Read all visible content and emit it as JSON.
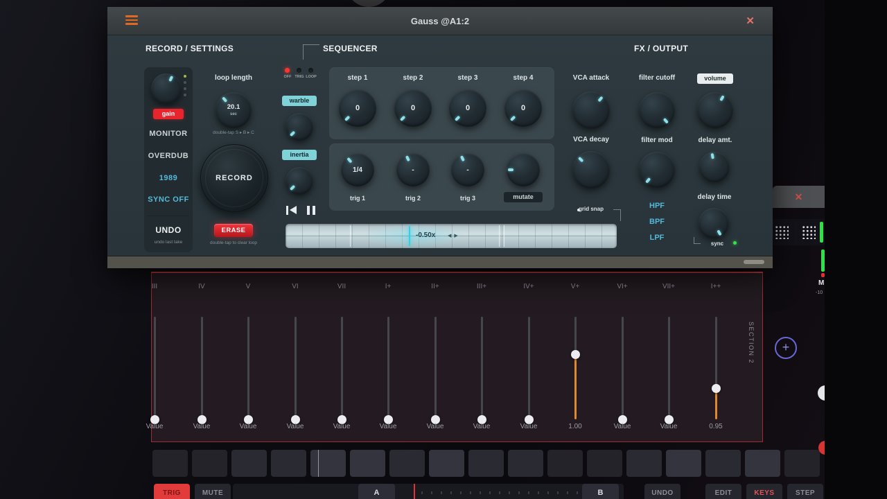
{
  "window": {
    "title": "Gauss @A1:2",
    "icons": {
      "close": "✕"
    }
  },
  "sections": {
    "record_header": "RECORD / SETTINGS",
    "sequencer_header": "SEQUENCER",
    "fx_header": "FX / OUTPUT"
  },
  "record": {
    "gain_badge": "gain",
    "monitor": "MONITOR",
    "overdub": "OVERDUB",
    "year": "1989",
    "sync": "SYNC OFF",
    "undo": "UNDO",
    "undo_hint": "undo last take",
    "loop_length_label": "loop length",
    "loop_value": "20.1",
    "loop_unit": "sec",
    "loop_hint": "double-tap  S ▸ B ▸ C",
    "record_button": "RECORD",
    "erase_button": "ERASE",
    "erase_hint": "double-tap to clear loop"
  },
  "sequencer": {
    "modes": [
      "OFF",
      "TRIG",
      "LOOP"
    ],
    "warble": "warble",
    "inertia": "inertia",
    "steps": [
      {
        "label": "step 1",
        "value": "0"
      },
      {
        "label": "step 2",
        "value": "0"
      },
      {
        "label": "step 3",
        "value": "0"
      },
      {
        "label": "step 4",
        "value": "0"
      }
    ],
    "trigs": [
      {
        "label": "trig 1",
        "value": "1/4"
      },
      {
        "label": "trig 2",
        "value": "-"
      },
      {
        "label": "trig 3",
        "value": "-"
      }
    ],
    "mutate": "mutate",
    "vca_attack": "VCA attack",
    "vca_decay": "VCA decay",
    "grid_snap": "grid snap",
    "speed_readout": "-0.50x",
    "scrub_arrows": "◀ ▶"
  },
  "fx": {
    "filter_cutoff": "filter cutoff",
    "volume": "volume",
    "filter_mod": "filter mod",
    "delay_amt": "delay amt.",
    "filter_types": [
      "HPF",
      "BPF",
      "LPF"
    ],
    "delay_time": "delay time",
    "sync": "sync"
  },
  "host": {
    "mixer": {
      "section_label": "SECTION 2",
      "columns": [
        {
          "label": "III",
          "value": "Value",
          "level": 0,
          "active": false
        },
        {
          "label": "IV",
          "value": "Value",
          "level": 0,
          "active": false
        },
        {
          "label": "V",
          "value": "Value",
          "level": 0,
          "active": false
        },
        {
          "label": "VI",
          "value": "Value",
          "level": 0,
          "active": false
        },
        {
          "label": "VII",
          "value": "Value",
          "level": 0,
          "active": false
        },
        {
          "label": "I+",
          "value": "Value",
          "level": 0,
          "active": false
        },
        {
          "label": "II+",
          "value": "Value",
          "level": 0,
          "active": false
        },
        {
          "label": "III+",
          "value": "Value",
          "level": 0,
          "active": false
        },
        {
          "label": "IV+",
          "value": "Value",
          "level": 0,
          "active": false
        },
        {
          "label": "V+",
          "value": "1.00",
          "level": 0.63,
          "active": true
        },
        {
          "label": "VI+",
          "value": "Value",
          "level": 0,
          "active": false
        },
        {
          "label": "VII+",
          "value": "Value",
          "level": 0,
          "active": false
        },
        {
          "label": "I++",
          "value": "0.95",
          "level": 0.3,
          "active": true
        }
      ]
    },
    "transport": {
      "trig": "TRIG",
      "mute": "MUTE",
      "a": "A",
      "b": "B",
      "undo": "UNDO",
      "edit": "EDIT",
      "keys": "KEYS",
      "step": "STEP"
    },
    "panel": {
      "close": "✕",
      "meter_label": "M",
      "meter_value": "-10"
    }
  }
}
